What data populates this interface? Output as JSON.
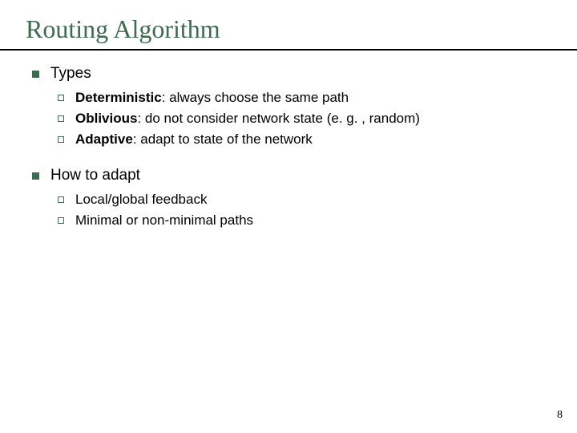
{
  "title": "Routing Algorithm",
  "sections": [
    {
      "heading": "Types",
      "items": [
        {
          "bold": "Deterministic",
          "rest": ": always choose the same path"
        },
        {
          "bold": "Oblivious",
          "rest": ": do not consider network state (e. g. , random)"
        },
        {
          "bold": "Adaptive",
          "rest": ": adapt to state of the network"
        }
      ]
    },
    {
      "heading": "How to adapt",
      "items": [
        {
          "bold": "",
          "rest": "Local/global feedback"
        },
        {
          "bold": "",
          "rest": "Minimal or non-minimal paths"
        }
      ]
    }
  ],
  "page_number": "8"
}
